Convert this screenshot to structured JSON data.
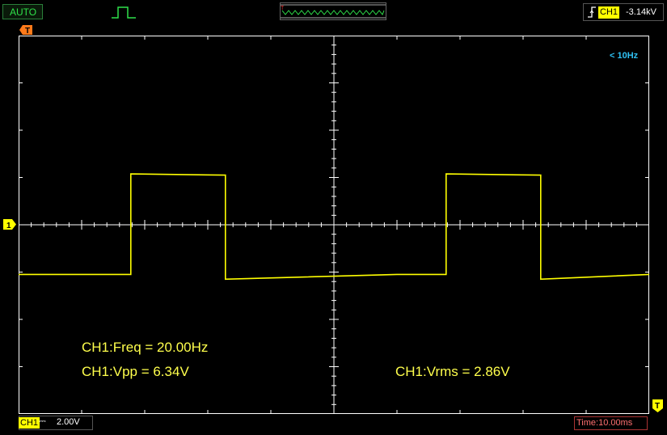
{
  "toolbar": {
    "mode_label": "AUTO",
    "trigger_channel": "CH1",
    "trigger_level": "-3.14kV"
  },
  "markers": {
    "time_marker": "T",
    "channel_marker": "1",
    "trigger_marker": "T"
  },
  "screen": {
    "freq_note": "< 10Hz"
  },
  "measurements": {
    "freq": "CH1:Freq = 20.00Hz",
    "vpp": "CH1:Vpp = 6.34V",
    "vrms": "CH1:Vrms = 2.86V"
  },
  "status": {
    "channel": "CH1",
    "volts_per_div": "2.00V",
    "time_per_div": "Time:10.00ms"
  },
  "colors": {
    "trace": "#ffff00",
    "grid": "#ffffff",
    "mode": "#2fe04a",
    "note": "#2ec0f2",
    "time": "#ff7070"
  },
  "chart_data": {
    "type": "line",
    "series": [
      {
        "x": [
          0,
          10,
          17.8,
          17.8,
          32.8,
          32.8,
          60,
          67.8,
          67.8,
          82.8,
          82.8,
          100
        ],
        "y": [
          -2.1,
          -2.1,
          -2.1,
          2.15,
          2.1,
          -2.3,
          -2.1,
          -2.1,
          2.15,
          2.1,
          -2.3,
          -2.1
        ]
      }
    ],
    "xlim": [
      0,
      100
    ],
    "ylim": [
      -8,
      8
    ],
    "grid": true
  }
}
